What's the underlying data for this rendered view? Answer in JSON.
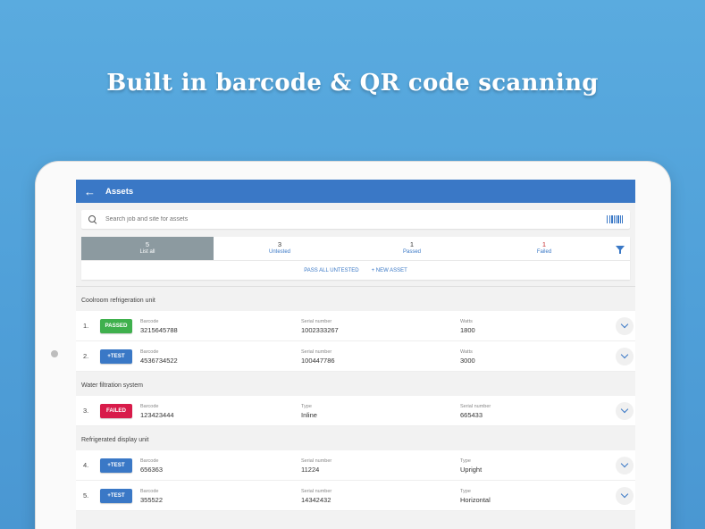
{
  "headline": "Built in barcode & QR code scanning",
  "app": {
    "title": "Assets",
    "back_icon": "arrow-left-icon",
    "search_placeholder": "Search job and site for assets"
  },
  "tabs": [
    {
      "count": "5",
      "label": "List all"
    },
    {
      "count": "3",
      "label": "Untested"
    },
    {
      "count": "1",
      "label": "Passed"
    },
    {
      "count": "1",
      "label": "Failed"
    }
  ],
  "actions": {
    "pass_all": "PASS ALL UNTESTED",
    "new_asset": "+ NEW ASSET"
  },
  "groups": [
    {
      "title": "Coolroom refrigeration unit",
      "rows": [
        {
          "num": "1.",
          "status": "PASSED",
          "kind": "passed",
          "f1_label": "Barcode",
          "f1": "3215645788",
          "f2_label": "Serial number",
          "f2": "1002333267",
          "f3_label": "Watts",
          "f3": "1800"
        },
        {
          "num": "2.",
          "status": "+TEST",
          "kind": "test",
          "f1_label": "Barcode",
          "f1": "4536734522",
          "f2_label": "Serial number",
          "f2": "100447786",
          "f3_label": "Watts",
          "f3": "3000"
        }
      ]
    },
    {
      "title": "Water filtration system",
      "rows": [
        {
          "num": "3.",
          "status": "FAILED",
          "kind": "failed",
          "f1_label": "Barcode",
          "f1": "123423444",
          "f2_label": "Type",
          "f2": "Inline",
          "f3_label": "Serial number",
          "f3": "665433"
        }
      ]
    },
    {
      "title": "Refrigerated display unit",
      "rows": [
        {
          "num": "4.",
          "status": "+TEST",
          "kind": "test",
          "f1_label": "Barcode",
          "f1": "656363",
          "f2_label": "Serial number",
          "f2": "11224",
          "f3_label": "Type",
          "f3": "Upright"
        },
        {
          "num": "5.",
          "status": "+TEST",
          "kind": "test",
          "f1_label": "Barcode",
          "f1": "355522",
          "f2_label": "Serial number",
          "f2": "14342432",
          "f3_label": "Type",
          "f3": "Horizontal"
        }
      ]
    }
  ],
  "colors": {
    "primary": "#3a78c6",
    "passed": "#3fb04d",
    "failed": "#d81b4a",
    "active_tab": "#8c9aa0"
  }
}
